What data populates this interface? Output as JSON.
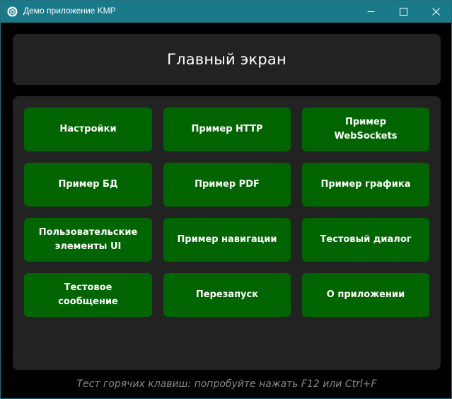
{
  "window": {
    "title": "Демо приложение KMP",
    "icon": "kmp-app-icon",
    "controls": [
      "minimize-icon",
      "maximize-icon",
      "close-icon"
    ]
  },
  "header": {
    "title": "Главный экран"
  },
  "menu": {
    "items": [
      {
        "label": "Настройки"
      },
      {
        "label": "Пример HTTP"
      },
      {
        "label": "Пример\nWebSockets"
      },
      {
        "label": "Пример БД"
      },
      {
        "label": "Пример PDF"
      },
      {
        "label": "Пример графика"
      },
      {
        "label": "Пользовательские\nэлементы UI"
      },
      {
        "label": "Пример навигации"
      },
      {
        "label": "Тестовый диалог"
      },
      {
        "label": "Тестовое\nсообщение"
      },
      {
        "label": "Перезапуск"
      },
      {
        "label": "О приложении"
      }
    ]
  },
  "footer": {
    "hint": "Тест горячих клавиш: попробуйте нажать F12 или Ctrl+F"
  },
  "colors": {
    "titlebar": "#1a7a8a",
    "background": "#000000",
    "card": "#222222",
    "tile": "#006400",
    "hint_text": "#8a8a8a"
  }
}
